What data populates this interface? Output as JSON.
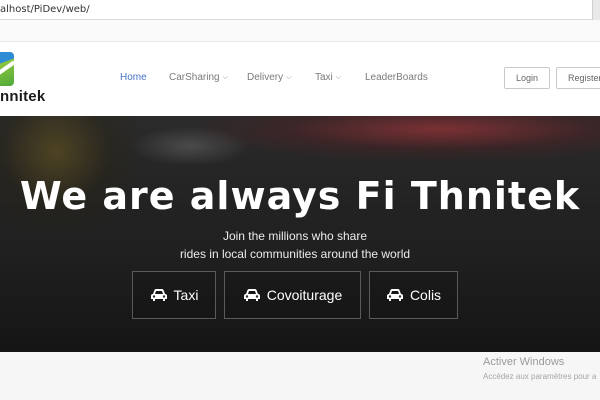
{
  "browser": {
    "url": "alhost/PiDev/web/"
  },
  "brand": {
    "name": "nnitek"
  },
  "nav": {
    "items": [
      {
        "label": "Home",
        "dropdown": false
      },
      {
        "label": "CarSharing",
        "dropdown": true
      },
      {
        "label": "Delivery",
        "dropdown": true
      },
      {
        "label": "Taxi",
        "dropdown": true
      },
      {
        "label": "LeaderBoards",
        "dropdown": false
      }
    ],
    "login_label": "Login",
    "register_label": "Register"
  },
  "hero": {
    "title": "We are always Fi Thnitek",
    "subtitle_line1": "Join the millions who share",
    "subtitle_line2": "rides in local communities around the world",
    "cards": [
      {
        "label": "Taxi",
        "icon": "car-icon"
      },
      {
        "label": "Covoiturage",
        "icon": "car-icon"
      },
      {
        "label": "Colis",
        "icon": "car-icon"
      }
    ]
  },
  "windows_watermark": {
    "title": "Activer Windows",
    "subtitle": "Accédez aux paramètres pour a"
  },
  "colors": {
    "nav_active": "#4a73c9",
    "nav_text": "#7a7a7a",
    "hero_bg": "#222222",
    "hero_text": "#ffffff"
  }
}
